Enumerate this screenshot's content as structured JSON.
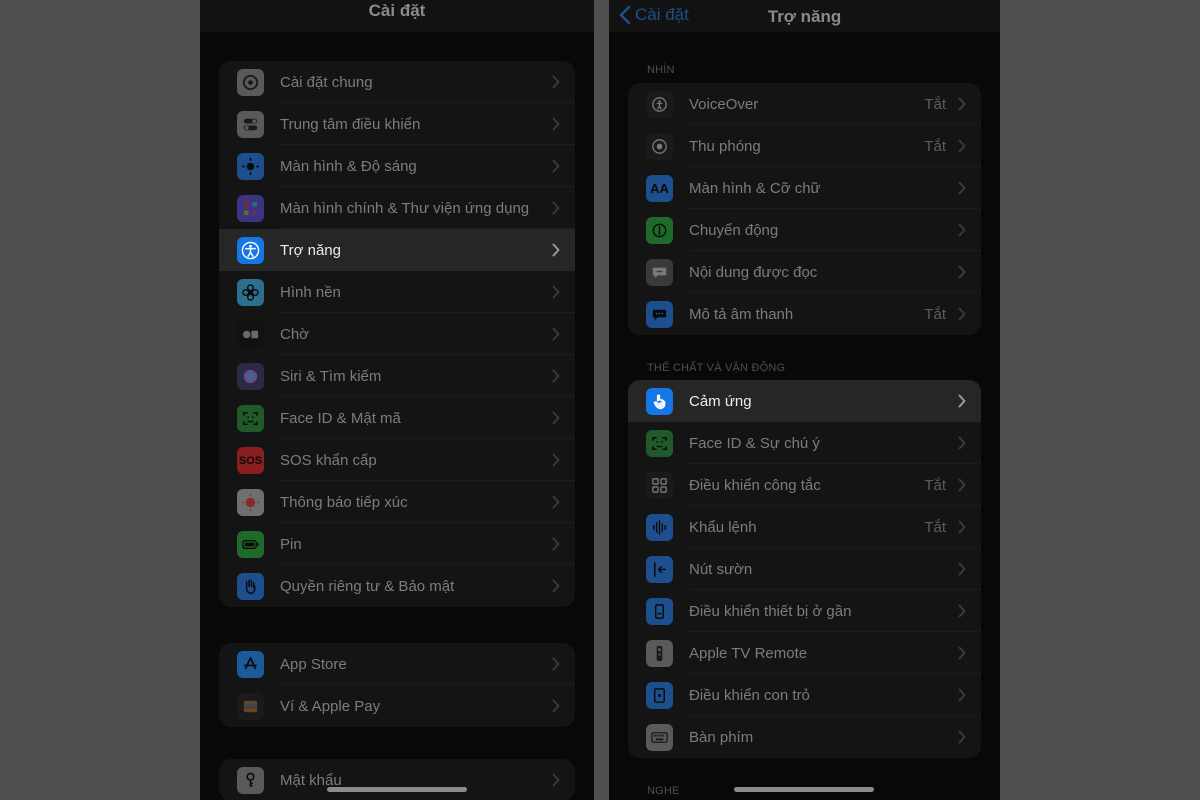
{
  "left": {
    "title": "Cài đặt",
    "groups": [
      {
        "items": [
          {
            "label": "Cài đặt chung",
            "icon": "gear-icon",
            "color": "#5a5a5a"
          },
          {
            "label": "Trung tâm điều khiển",
            "icon": "toggles-icon",
            "color": "#5a5a5a"
          },
          {
            "label": "Màn hình & Độ sáng",
            "icon": "sun-icon",
            "color": "#1d4f8e"
          },
          {
            "label": "Màn hình chính & Thư viện ứng dụng",
            "icon": "grid-apps-icon",
            "color": "#3b3480"
          },
          {
            "label": "Trợ năng",
            "icon": "accessibility-icon",
            "color": "#1577e6",
            "highlighted": true
          },
          {
            "label": "Hình nền",
            "icon": "flower-icon",
            "color": "#2e6f8f"
          },
          {
            "label": "Chờ",
            "icon": "standby-icon",
            "color": "#111111"
          },
          {
            "label": "Siri & Tìm kiếm",
            "icon": "siri-icon",
            "color": "#2a2a44"
          },
          {
            "label": "Face ID & Mật mã",
            "icon": "face-id-icon",
            "color": "#1f5a28"
          },
          {
            "label": "SOS khẩn cấp",
            "icon": "sos-icon",
            "color": "#8a1f1f",
            "glyph": "SOS"
          },
          {
            "label": "Thông báo tiếp xúc",
            "icon": "exposure-icon",
            "color": "#6f6f6f"
          },
          {
            "label": "Pin",
            "icon": "battery-icon",
            "color": "#1f6a2a"
          },
          {
            "label": "Quyền riêng tư & Bảo mật",
            "icon": "hand-icon",
            "color": "#1d4f8e"
          }
        ]
      },
      {
        "items": [
          {
            "label": "App Store",
            "icon": "app-store-icon",
            "color": "#1d5a9a"
          },
          {
            "label": "Ví & Apple Pay",
            "icon": "wallet-icon",
            "color": "#1a1a1a"
          }
        ]
      },
      {
        "items": [
          {
            "label": "Mật khẩu",
            "icon": "key-icon",
            "color": "#5a5a5a"
          }
        ]
      }
    ]
  },
  "right": {
    "back_label": "Cài đặt",
    "title": "Trợ năng",
    "sections": [
      {
        "header": "NHÌN",
        "items": [
          {
            "label": "VoiceOver",
            "value": "Tắt",
            "icon": "voiceover-icon",
            "color": "#1a1a1a"
          },
          {
            "label": "Thu phóng",
            "value": "Tắt",
            "icon": "zoom-icon",
            "color": "#1a1a1a"
          },
          {
            "label": "Màn hình & Cỡ chữ",
            "icon": "text-size-icon",
            "color": "#1d4f8e",
            "glyph": "AA"
          },
          {
            "label": "Chuyển động",
            "icon": "motion-icon",
            "color": "#1f6a2a"
          },
          {
            "label": "Nội dung được đọc",
            "icon": "spoken-content-icon",
            "color": "#3a3a3a"
          },
          {
            "label": "Mô tả âm thanh",
            "value": "Tắt",
            "icon": "audio-description-icon",
            "color": "#1d4f8e"
          }
        ]
      },
      {
        "header": "THỂ CHẤT VÀ VẬN ĐỘNG",
        "items": [
          {
            "label": "Cảm ứng",
            "icon": "touch-icon",
            "color": "#1577e6",
            "highlighted": true
          },
          {
            "label": "Face ID & Sự chú ý",
            "icon": "face-id-icon",
            "color": "#1f5a28"
          },
          {
            "label": "Điều khiển công tắc",
            "value": "Tắt",
            "icon": "switch-control-icon",
            "color": "#1a1a1a"
          },
          {
            "label": "Khẩu lệnh",
            "value": "Tắt",
            "icon": "voice-control-icon",
            "color": "#1d4f8e"
          },
          {
            "label": "Nút sườn",
            "icon": "side-button-icon",
            "color": "#1d4f8e"
          },
          {
            "label": "Điều khiển thiết bị ở gần",
            "icon": "nearby-devices-icon",
            "color": "#1d4f8e"
          },
          {
            "label": "Apple TV Remote",
            "icon": "tv-remote-icon",
            "color": "#5a5a5a"
          },
          {
            "label": "Điều khiển con trỏ",
            "icon": "pointer-icon",
            "color": "#1d4f8e"
          },
          {
            "label": "Bàn phím",
            "icon": "keyboard-icon",
            "color": "#5a5a5a"
          }
        ]
      },
      {
        "header": "NGHE",
        "items": []
      }
    ]
  }
}
